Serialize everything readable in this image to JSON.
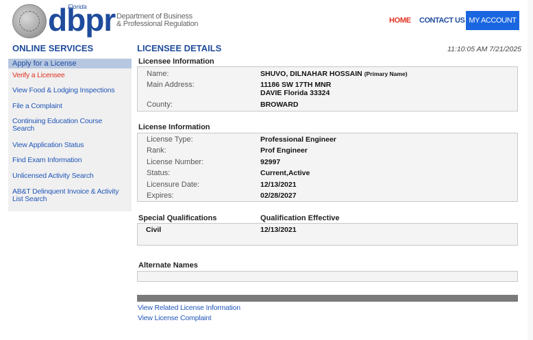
{
  "header": {
    "logo_text": "dbpr",
    "logo_state": "Florida",
    "department_line1": "Department of Business",
    "department_line2": "& Professional Regulation",
    "nav": {
      "home": "HOME",
      "contact": "CONTACT US",
      "account": "MY ACCOUNT"
    }
  },
  "sidebar": {
    "title": "ONLINE SERVICES",
    "apply_label": "Apply for a License",
    "items": [
      {
        "label": "Verify a Licensee"
      },
      {
        "label": "View Food & Lodging Inspections"
      },
      {
        "label": "File a Complaint"
      },
      {
        "label_line1": "Continuing Education Course",
        "label_line2": "Search"
      },
      {
        "label": "View Application Status"
      },
      {
        "label": "Find Exam Information"
      },
      {
        "label": "Unlicensed Activity Search"
      },
      {
        "label_line1": "AB&T Delinquent Invoice & Activity",
        "label_line2": "List Search"
      }
    ]
  },
  "main": {
    "title": "LICENSEE DETAILS",
    "timestamp": "11:10:05 AM 7/21/2025",
    "licensee": {
      "heading": "Licensee Information",
      "name_label": "Name:",
      "name_value": "SHUVO, DILNAHAR HOSSAIN",
      "name_suffix": "(Primary Name)",
      "address_label": "Main Address:",
      "address_line1": "11186 SW 17TH MNR",
      "address_line2": "DAVIE  Florida  33324",
      "county_label": "County:",
      "county_value": "BROWARD"
    },
    "license": {
      "heading": "License Information",
      "rows": [
        {
          "label": "License Type:",
          "value": "Professional Engineer"
        },
        {
          "label": "Rank:",
          "value": "Prof Engineer"
        },
        {
          "label": "License Number:",
          "value": "92997"
        },
        {
          "label": "Status:",
          "value": "Current,Active"
        },
        {
          "label": "Licensure Date:",
          "value": "12/13/2021"
        },
        {
          "label": "Expires:",
          "value": "02/28/2027"
        }
      ]
    },
    "special": {
      "heading_left": "Special Qualifications",
      "heading_right": "Qualification Effective",
      "qualification": "Civil",
      "effective": "12/13/2021"
    },
    "alternate": {
      "heading": "Alternate Names"
    },
    "links": {
      "related": "View Related License Information",
      "complaint": "View License Complaint"
    }
  }
}
